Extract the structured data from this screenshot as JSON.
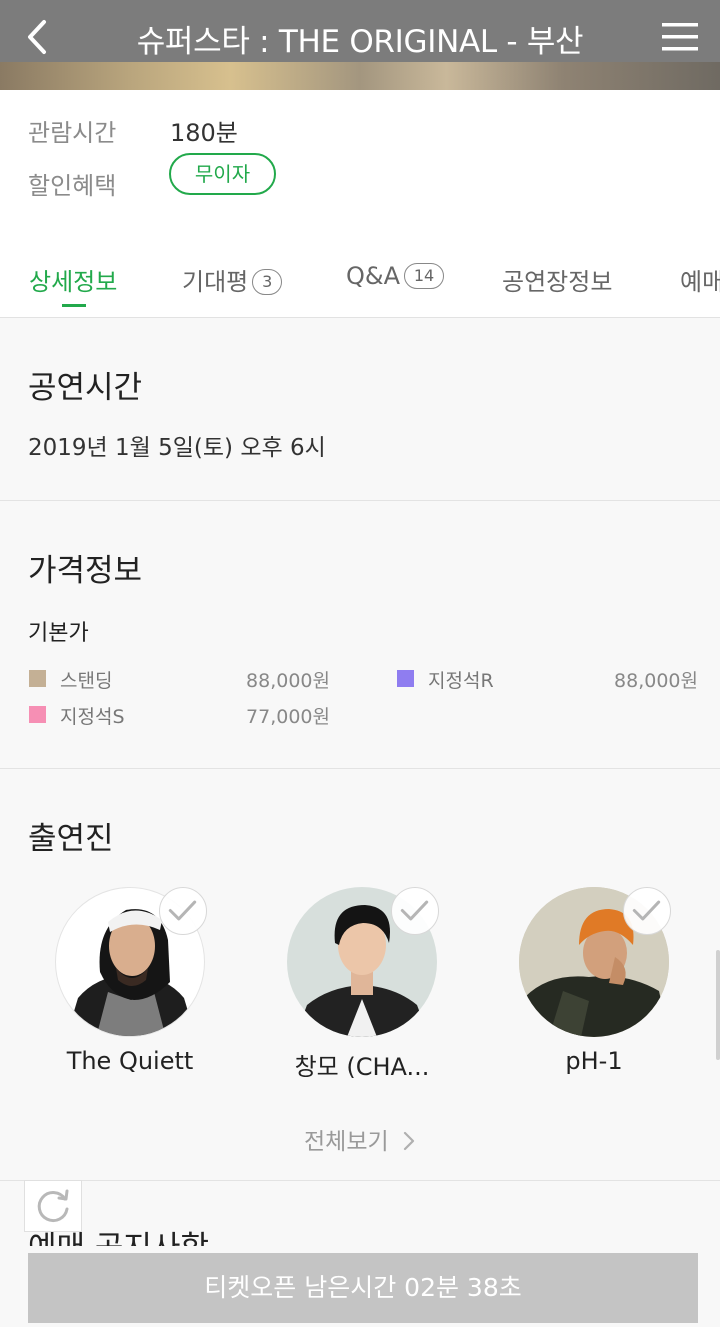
{
  "header": {
    "title": "슈퍼스타 : THE ORIGINAL - 부산",
    "back_icon": "chevron-left-icon",
    "menu_icon": "hamburger-menu-icon"
  },
  "info": {
    "runtime_label": "관람시간",
    "runtime_value": "180분",
    "discount_label": "할인혜택",
    "discount_badge": "무이자"
  },
  "tabs": [
    {
      "label": "상세정보",
      "active": true
    },
    {
      "label": "기대평",
      "count": "3"
    },
    {
      "label": "Q&A",
      "count": "14"
    },
    {
      "label": "공연장정보"
    },
    {
      "label": "예매"
    }
  ],
  "showtime": {
    "title": "공연시간",
    "value": "2019년 1월 5일(토) 오후 6시"
  },
  "pricing": {
    "title": "가격정보",
    "subtitle": "기본가",
    "items": [
      {
        "name": "스탠딩",
        "price": "88,000원",
        "color": "#c4b095"
      },
      {
        "name": "지정석R",
        "price": "88,000원",
        "color": "#8f7df0"
      },
      {
        "name": "지정석S",
        "price": "77,000원",
        "color": "#f68fb4"
      }
    ]
  },
  "cast": {
    "title": "출연진",
    "members": [
      {
        "name": "The Quiett"
      },
      {
        "name": "창모 (CHA..."
      },
      {
        "name": "pH-1"
      }
    ],
    "view_all": "전체보기"
  },
  "next_section": {
    "title": "예매 공지사항"
  },
  "refresh_icon": "refresh-icon",
  "ticket_button": "티켓오픈 남은시간 02분 38초",
  "colors": {
    "accent": "#22a94b",
    "header_bar": "#7c7c7c",
    "button_disabled": "#c4c4c4"
  }
}
